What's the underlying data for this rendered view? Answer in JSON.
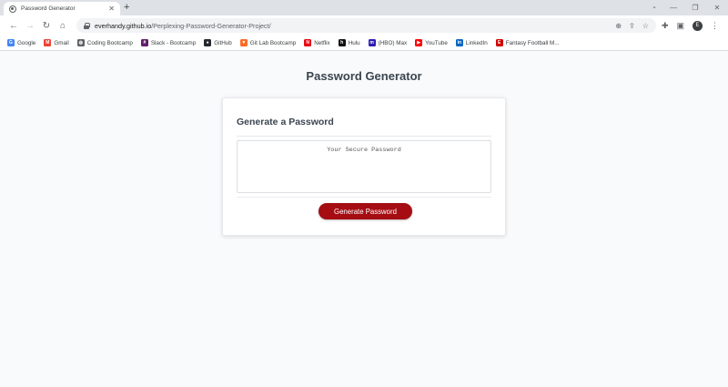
{
  "browser": {
    "tab_title": "Password Generator",
    "tab_close": "✕",
    "new_tab": "+",
    "url_host": "everhandy.github.io",
    "url_path": "/Perplexing-Password-Generator-Project/",
    "profile_initial": "E",
    "bookmarks": [
      {
        "label": "Google",
        "icon": "google-icon",
        "color": "#4285f4",
        "glyph": "G"
      },
      {
        "label": "Gmail",
        "icon": "gmail-icon",
        "color": "#ea4335",
        "glyph": "M"
      },
      {
        "label": "Coding Bootcamp",
        "icon": "globe-icon",
        "color": "#5f6368",
        "glyph": "◍"
      },
      {
        "label": "Slack - Bootcamp",
        "icon": "slack-icon",
        "color": "#611f69",
        "glyph": "#"
      },
      {
        "label": "GitHub",
        "icon": "github-icon",
        "color": "#24292f",
        "glyph": "●"
      },
      {
        "label": "Git Lab Bootcamp",
        "icon": "gitlab-icon",
        "color": "#fc6d26",
        "glyph": "▼"
      },
      {
        "label": "Netflix",
        "icon": "netflix-icon",
        "color": "#e50914",
        "glyph": "N"
      },
      {
        "label": "Hulu",
        "icon": "hulu-icon",
        "color": "#111111",
        "glyph": "h"
      },
      {
        "label": "(HBO) Max",
        "icon": "hbo-max-icon",
        "color": "#2c1eb3",
        "glyph": "m"
      },
      {
        "label": "YouTube",
        "icon": "youtube-icon",
        "color": "#ff0000",
        "glyph": "▶"
      },
      {
        "label": "LinkedIn",
        "icon": "linkedin-icon",
        "color": "#0a66c2",
        "glyph": "in"
      },
      {
        "label": "Fantasy Football M...",
        "icon": "espn-icon",
        "color": "#d00000",
        "glyph": "E"
      }
    ]
  },
  "page": {
    "title": "Password Generator",
    "card_header": "Generate a Password",
    "password_placeholder": "Your Secure Password",
    "generate_button": "Generate Password"
  },
  "colors": {
    "button": "#a50d12",
    "heading": "#3a4550"
  }
}
